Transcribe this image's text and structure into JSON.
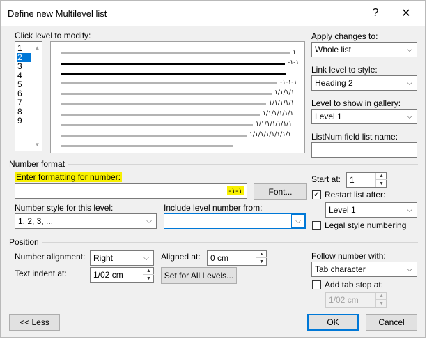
{
  "window": {
    "title": "Define new Multilevel list",
    "help_glyph": "?",
    "close_glyph": "✕"
  },
  "level_list": {
    "label": "Click level to modify:",
    "items": [
      "1",
      "2",
      "3",
      "4",
      "5",
      "6",
      "7",
      "8",
      "9"
    ],
    "selected": "2"
  },
  "preview": {
    "numbers": [
      "١",
      "-١-١",
      "",
      "-١-١-١",
      "١/١/١/١",
      "١/١/١/١/١",
      "١/١/١/١/١/١",
      "١/١/١/١/١/١/١",
      "١/١/١/١/١/١/١/١"
    ]
  },
  "apply_changes": {
    "label": "Apply changes to:",
    "value": "Whole list"
  },
  "link_level": {
    "label": "Link level to style:",
    "value": "Heading 2"
  },
  "gallery_level": {
    "label": "Level to show in gallery:",
    "value": "Level 1"
  },
  "listnum": {
    "label": "ListNum field list name:",
    "value": ""
  },
  "number_format": {
    "section_label": "Number format",
    "enter_label": "Enter formatting for number:",
    "format_value": "-١-١",
    "font_button": "Font...",
    "style_label": "Number style for this level:",
    "style_value": "1, 2, 3, ...",
    "include_label": "Include level number from:",
    "include_value": ""
  },
  "start": {
    "start_label": "Start at:",
    "start_value": "1",
    "restart_label": "Restart list after:",
    "restart_checked": true,
    "restart_value": "Level 1",
    "legal_label": "Legal style numbering",
    "legal_checked": false
  },
  "position": {
    "section_label": "Position",
    "alignment_label": "Number alignment:",
    "alignment_value": "Right",
    "aligned_at_label": "Aligned at:",
    "aligned_at_value": "0 cm",
    "indent_label": "Text indent at:",
    "indent_value": "1/02 cm",
    "set_all_button": "Set for All Levels...",
    "follow_label": "Follow number with:",
    "follow_value": "Tab character",
    "tab_stop_label": "Add tab stop at:",
    "tab_stop_checked": false,
    "tab_stop_value": "1/02 cm"
  },
  "footer": {
    "less_button": "<< Less",
    "ok_button": "OK",
    "cancel_button": "Cancel"
  },
  "colors": {
    "selection": "#0078d7",
    "highlight": "#f8f000",
    "dialog_bg": "#f0f0f0"
  }
}
